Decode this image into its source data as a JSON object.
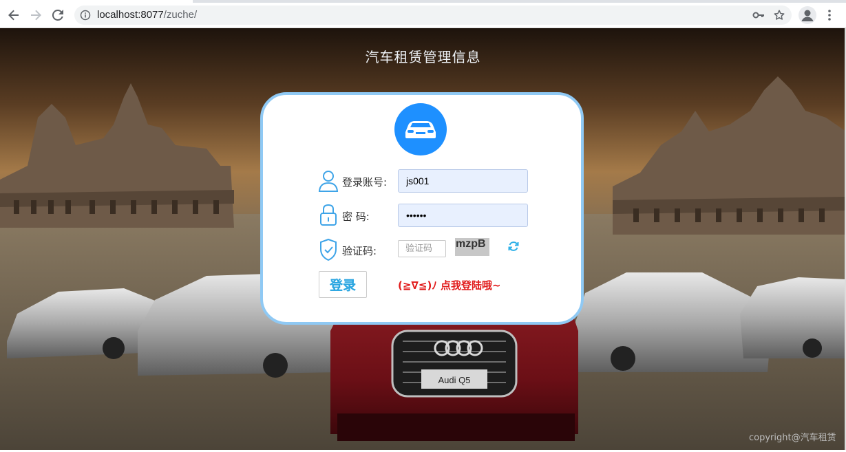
{
  "browser": {
    "url_host": "localhost:8077",
    "url_path": "/zuche/",
    "back_icon": "arrow-left",
    "forward_icon": "arrow-right",
    "reload_icon": "reload",
    "info_icon": "info",
    "key_icon": "key",
    "star_icon": "star",
    "profile_icon": "person",
    "menu_icon": "more-vert"
  },
  "page": {
    "title": "汽车租赁管理信息",
    "copyright": "copyright@汽车租赁"
  },
  "login": {
    "logo_icon": "car",
    "account_label": "登录账号:",
    "account_value": "js001",
    "password_label": "密 码:",
    "password_value": "••••••",
    "captcha_label": "验证码:",
    "captcha_placeholder": "验证码",
    "captcha_code": "mzpB",
    "refresh_icon": "refresh",
    "login_button": "登录",
    "hint": "(≧∇≦)ﾉ  点我登陆哦~"
  },
  "colors": {
    "accent": "#1e90ff",
    "card_border": "#8fc9f4",
    "hint": "#e11b1b",
    "button_text": "#2ba6e1"
  }
}
